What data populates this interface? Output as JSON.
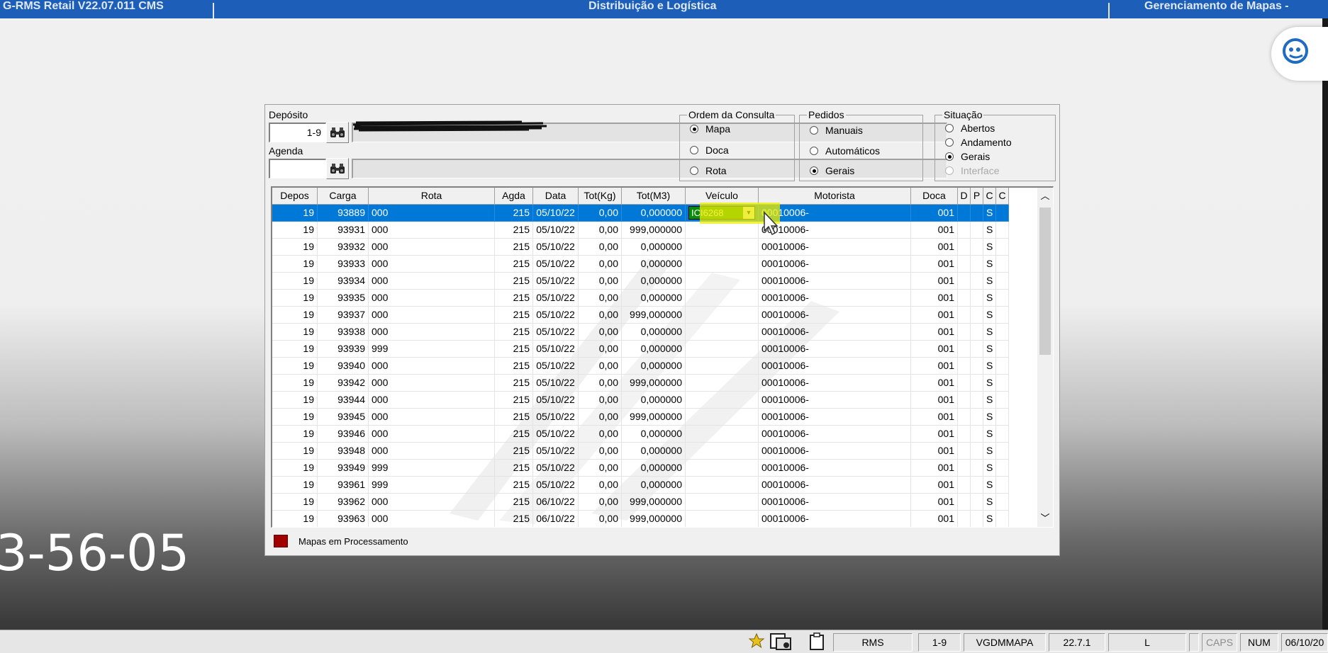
{
  "titlebar": {
    "left": "G-RMS Retail V22.07.011 CMS",
    "center": "Distribuição e Logística",
    "right": "Gerenciamento de Mapas -"
  },
  "deposito": {
    "label": "Depósito",
    "value": "1-9"
  },
  "agenda": {
    "label": "Agenda",
    "value": ""
  },
  "ordem": {
    "legend": "Ordem da Consulta",
    "options": [
      "Mapa",
      "Doca",
      "Rota"
    ],
    "selected": "Mapa"
  },
  "pedidos": {
    "legend": "Pedidos",
    "options": [
      "Manuais",
      "Automáticos",
      "Gerais"
    ],
    "selected": "Gerais"
  },
  "situacao": {
    "legend": "Situação",
    "options": [
      "Abertos",
      "Andamento",
      "Gerais",
      "Interface"
    ],
    "selected": "Gerais",
    "disabled": [
      "Interface"
    ]
  },
  "grid": {
    "headers": [
      "Depos",
      "Carga",
      "Rota",
      "Agda",
      "Data",
      "Tot(Kg)",
      "Tot(M3)",
      "Veículo",
      "Motorista",
      "Doca",
      "D",
      "P",
      "C",
      "C"
    ],
    "selected_index": 0,
    "rows": [
      [
        "19",
        "93889",
        "000",
        "215",
        "05/10/22",
        "0,00",
        "0,000000",
        "ICI6268",
        "00010006-",
        "001",
        "",
        "",
        "S",
        ""
      ],
      [
        "19",
        "93931",
        "000",
        "215",
        "05/10/22",
        "0,00",
        "999,000000",
        "",
        "00010006-",
        "001",
        "",
        "",
        "S",
        ""
      ],
      [
        "19",
        "93932",
        "000",
        "215",
        "05/10/22",
        "0,00",
        "0,000000",
        "",
        "00010006-",
        "001",
        "",
        "",
        "S",
        ""
      ],
      [
        "19",
        "93933",
        "000",
        "215",
        "05/10/22",
        "0,00",
        "0,000000",
        "",
        "00010006-",
        "001",
        "",
        "",
        "S",
        ""
      ],
      [
        "19",
        "93934",
        "000",
        "215",
        "05/10/22",
        "0,00",
        "0,000000",
        "",
        "00010006-",
        "001",
        "",
        "",
        "S",
        ""
      ],
      [
        "19",
        "93935",
        "000",
        "215",
        "05/10/22",
        "0,00",
        "0,000000",
        "",
        "00010006-",
        "001",
        "",
        "",
        "S",
        ""
      ],
      [
        "19",
        "93937",
        "000",
        "215",
        "05/10/22",
        "0,00",
        "999,000000",
        "",
        "00010006-",
        "001",
        "",
        "",
        "S",
        ""
      ],
      [
        "19",
        "93938",
        "000",
        "215",
        "05/10/22",
        "0,00",
        "0,000000",
        "",
        "00010006-",
        "001",
        "",
        "",
        "S",
        ""
      ],
      [
        "19",
        "93939",
        "999",
        "215",
        "05/10/22",
        "0,00",
        "0,000000",
        "",
        "00010006-",
        "001",
        "",
        "",
        "S",
        ""
      ],
      [
        "19",
        "93940",
        "000",
        "215",
        "05/10/22",
        "0,00",
        "0,000000",
        "",
        "00010006-",
        "001",
        "",
        "",
        "S",
        ""
      ],
      [
        "19",
        "93942",
        "000",
        "215",
        "05/10/22",
        "0,00",
        "999,000000",
        "",
        "00010006-",
        "001",
        "",
        "",
        "S",
        ""
      ],
      [
        "19",
        "93944",
        "000",
        "215",
        "05/10/22",
        "0,00",
        "0,000000",
        "",
        "00010006-",
        "001",
        "",
        "",
        "S",
        ""
      ],
      [
        "19",
        "93945",
        "000",
        "215",
        "05/10/22",
        "0,00",
        "999,000000",
        "",
        "00010006-",
        "001",
        "",
        "",
        "S",
        ""
      ],
      [
        "19",
        "93946",
        "000",
        "215",
        "05/10/22",
        "0,00",
        "0,000000",
        "",
        "00010006-",
        "001",
        "",
        "",
        "S",
        ""
      ],
      [
        "19",
        "93948",
        "000",
        "215",
        "05/10/22",
        "0,00",
        "0,000000",
        "",
        "00010006-",
        "001",
        "",
        "",
        "S",
        ""
      ],
      [
        "19",
        "93949",
        "999",
        "215",
        "05/10/22",
        "0,00",
        "0,000000",
        "",
        "00010006-",
        "001",
        "",
        "",
        "S",
        ""
      ],
      [
        "19",
        "93961",
        "999",
        "215",
        "05/10/22",
        "0,00",
        "0,000000",
        "",
        "00010006-",
        "001",
        "",
        "",
        "S",
        ""
      ],
      [
        "19",
        "93962",
        "000",
        "215",
        "06/10/22",
        "0,00",
        "999,000000",
        "",
        "00010006-",
        "001",
        "",
        "",
        "S",
        ""
      ],
      [
        "19",
        "93963",
        "000",
        "215",
        "06/10/22",
        "0,00",
        "999,000000",
        "",
        "00010006-",
        "001",
        "",
        "",
        "S",
        ""
      ]
    ]
  },
  "legend_label": "Mapas em Processamento",
  "overlay_time": "3-56-05",
  "statusbar": {
    "app": "RMS",
    "deposito": "1-9",
    "program": "VGDMMAPA",
    "version": "22.7.1",
    "mode": "L",
    "caps": "CAPS",
    "num": "NUM",
    "date": "06/10/20"
  },
  "colors": {
    "titlebar": "#1d5fb8",
    "selection": "#0078d7",
    "highlight": "#eeee00",
    "vehicle_bg": "#0a8a0a",
    "legend_swatch": "#a00000"
  },
  "icons": [
    "binoculars-icon",
    "star-icon",
    "window-icon",
    "clipboard-icon",
    "assistant-icon"
  ]
}
